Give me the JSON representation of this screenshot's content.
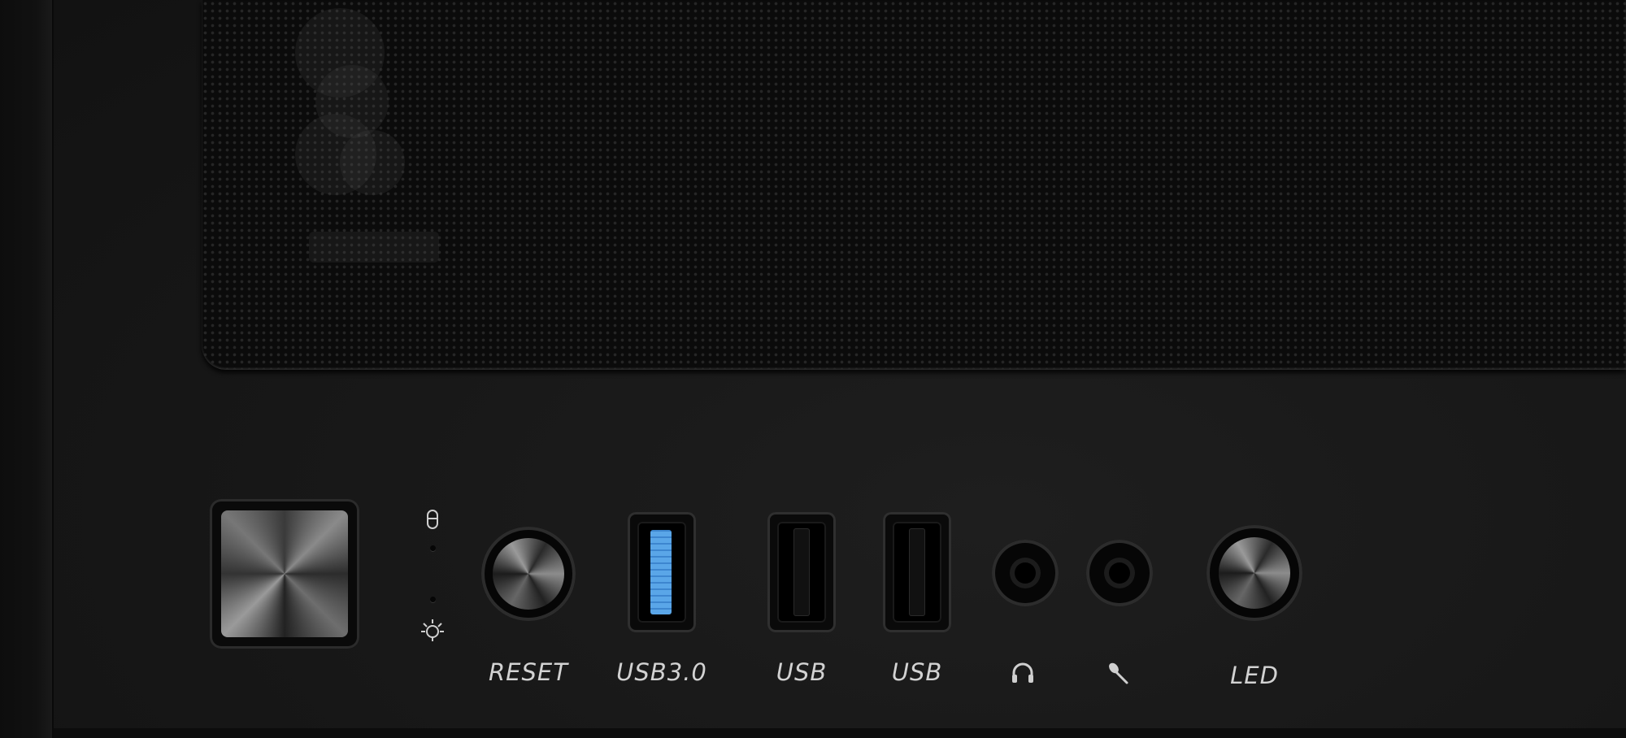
{
  "io_panel": {
    "reset": {
      "label": "RESET"
    },
    "usb3_port": {
      "label": "USB3.0",
      "port_color": "#4a95dc"
    },
    "usb_port_1": {
      "label": "USB"
    },
    "usb_port_2": {
      "label": "USB"
    },
    "led_button": {
      "label": "LED"
    },
    "indicators": {
      "hdd_icon": "drive-icon",
      "power_icon": "bulb-icon"
    },
    "audio": {
      "headphone_icon": "headphones-icon",
      "mic_icon": "microphone-icon"
    }
  },
  "colors": {
    "case": "#141414",
    "mesh": "#0b0b0b",
    "label": "#d2d2d2"
  }
}
